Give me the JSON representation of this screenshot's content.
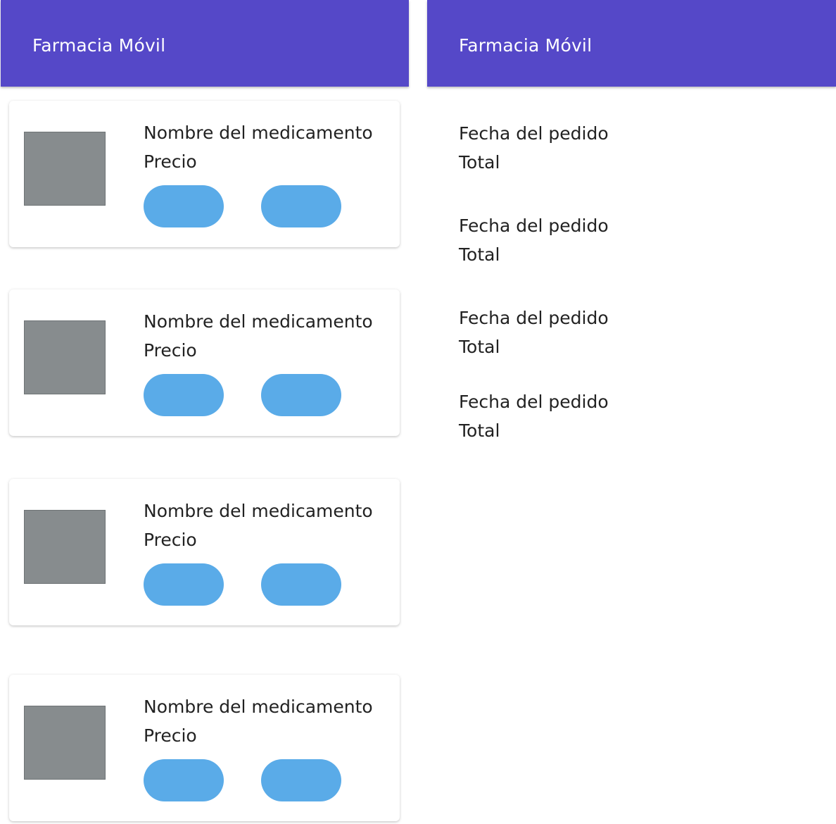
{
  "left_screen": {
    "app_bar": {
      "title": "Farmacia Móvil"
    },
    "products": [
      {
        "name": "Nombre del medicamento",
        "price": "Precio"
      },
      {
        "name": "Nombre del medicamento",
        "price": "Precio"
      },
      {
        "name": "Nombre del medicamento",
        "price": "Precio"
      },
      {
        "name": "Nombre del medicamento",
        "price": "Precio"
      }
    ]
  },
  "right_screen": {
    "app_bar": {
      "title": "Farmacia Móvil"
    },
    "orders": [
      {
        "date": "Fecha del pedido",
        "total": "Total"
      },
      {
        "date": "Fecha del pedido",
        "total": "Total"
      },
      {
        "date": "Fecha del pedido",
        "total": "Total"
      },
      {
        "date": "Fecha del pedido",
        "total": "Total"
      }
    ]
  },
  "colors": {
    "app_bar": "#5548c8",
    "button": "#5aabe8",
    "image_placeholder": "#878c8e"
  }
}
